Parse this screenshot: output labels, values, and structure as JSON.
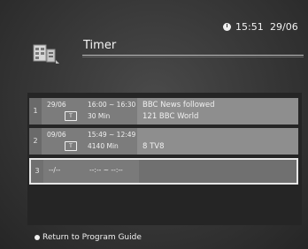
{
  "status": {
    "time": "15:51",
    "date": "29/06"
  },
  "header": {
    "title": "Timer",
    "icon": "timer-icon"
  },
  "timers": [
    {
      "number": "1",
      "date": "29/06",
      "time_range": "16:00 ~ 16:30",
      "duration": "30 Min",
      "mode_icon": "T",
      "program": "BBC News followed",
      "channel": "121  BBC World"
    },
    {
      "number": "2",
      "date": "09/06",
      "time_range": "15:49 ~ 12:49",
      "duration": "4140 Min",
      "mode_icon": "T",
      "program": "",
      "channel": "8  TV8"
    },
    {
      "number": "3",
      "date": "--/--",
      "time_range": "--:-- ~ --:--",
      "duration": "",
      "mode_icon": "",
      "program": "",
      "channel": ""
    }
  ],
  "footer": {
    "label": "Return to Program Guide"
  },
  "colors": {
    "background": "#3a3a3a",
    "row_bg": "#8e8e8e",
    "list_bg": "#252525"
  }
}
